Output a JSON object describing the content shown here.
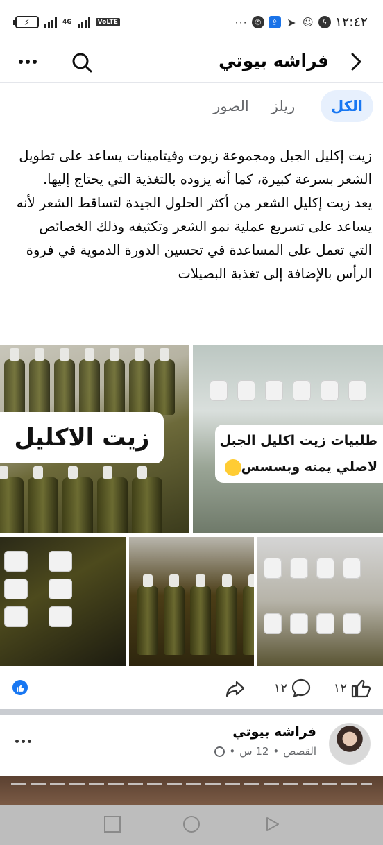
{
  "status_bar": {
    "time": "١٢:٤٢",
    "network_label": "4G",
    "volte_label": "VoLTE",
    "more_dots": "···"
  },
  "header": {
    "title": "فراشه بيوتي",
    "icons": [
      "back-arrow-icon",
      "search-icon",
      "more-icon"
    ]
  },
  "tabs": [
    {
      "label": "الكل",
      "active": true
    },
    {
      "label": "ريلز",
      "active": false
    },
    {
      "label": "الصور",
      "active": false
    }
  ],
  "post": {
    "paragraph1": "زيت إكليل الجبل  ومجموعة زيوت وفيتامينات            يساعد على تطويل الشعر بسرعة كبيرة، كما أنه يزوده بالتغذية التي يحتاج إليها.",
    "paragraph2": "يعد زيت إكليل الشعر من أكثر الحلول الجيدة لتساقط الشعر لأنه يساعد على تسريع عملية نمو الشعر وتكثيفه وذلك الخصائص التي تعمل على المساعدة في تحسين الدورة الدموية في فروة الرأس بالإضافة إلى تغذية البصيلات",
    "images": [
      {
        "overlay_text": "زيت الاكليل"
      },
      {
        "overlay_line1": "طلبيات زيت اكليل الجبل",
        "overlay_line2": "لاصلي يمنه وبسسس"
      },
      {},
      {},
      {}
    ],
    "reactions": {
      "like_count": "١٢",
      "comment_count": "١٢"
    }
  },
  "next_post": {
    "author": "فراشه بيوتي",
    "meta_source": "القصص",
    "meta_time": "12 س"
  },
  "colors": {
    "accent": "#1877f2",
    "tab_active_bg": "#e7f0fd",
    "muted_text": "#65676b",
    "nav_bar": "#bdbdbd"
  }
}
